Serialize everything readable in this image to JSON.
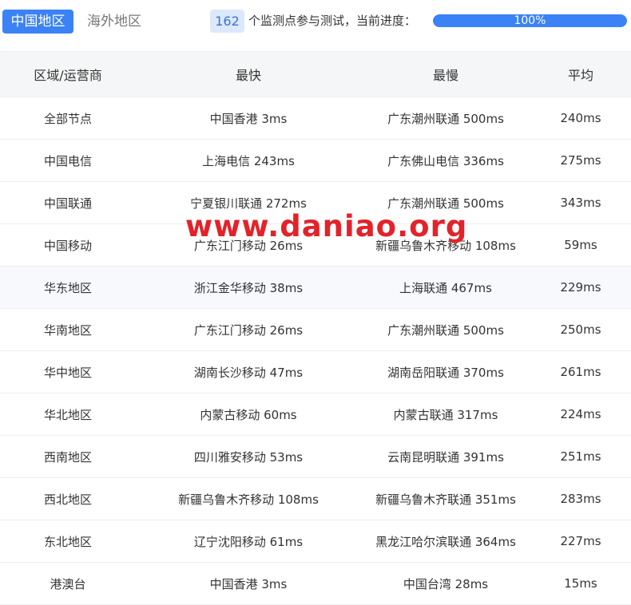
{
  "tabs": {
    "active_label": "中国地区",
    "inactive_label": "海外地区"
  },
  "monitor": {
    "count": "162",
    "text": "个监测点参与测试，当前进度：",
    "progress_label": "100%",
    "progress_fraction": 1.0
  },
  "table": {
    "headers": [
      "区域/运营商",
      "最快",
      "最慢",
      "平均"
    ],
    "rows": [
      [
        "全部节点",
        "中国香港 3ms",
        "广东潮州联通 500ms",
        "240ms"
      ],
      [
        "中国电信",
        "上海电信 243ms",
        "广东佛山电信 336ms",
        "275ms"
      ],
      [
        "中国联通",
        "宁夏银川联通 272ms",
        "广东潮州联通 500ms",
        "343ms"
      ],
      [
        "中国移动",
        "广东江门移动 26ms",
        "新疆乌鲁木齐移动 108ms",
        "59ms"
      ],
      [
        "华东地区",
        "浙江金华移动 38ms",
        "上海联通 467ms",
        "229ms"
      ],
      [
        "华南地区",
        "广东江门移动 26ms",
        "广东潮州联通 500ms",
        "250ms"
      ],
      [
        "华中地区",
        "湖南长沙移动 47ms",
        "湖南岳阳联通 370ms",
        "261ms"
      ],
      [
        "华北地区",
        "内蒙古移动 60ms",
        "内蒙古联通 317ms",
        "224ms"
      ],
      [
        "西南地区",
        "四川雅安移动 53ms",
        "云南昆明联通 391ms",
        "251ms"
      ],
      [
        "西北地区",
        "新疆乌鲁木齐移动 108ms",
        "新疆乌鲁木齐联通 351ms",
        "283ms"
      ],
      [
        "东北地区",
        "辽宁沈阳移动 61ms",
        "黑龙江哈尔滨联通 364ms",
        "227ms"
      ],
      [
        "港澳台",
        "中国香港 3ms",
        "中国台湾 28ms",
        "15ms"
      ]
    ]
  },
  "watermark": "www.daniao.org",
  "colors": {
    "accent": "#3b82f6",
    "watermark": "#e3222a"
  }
}
